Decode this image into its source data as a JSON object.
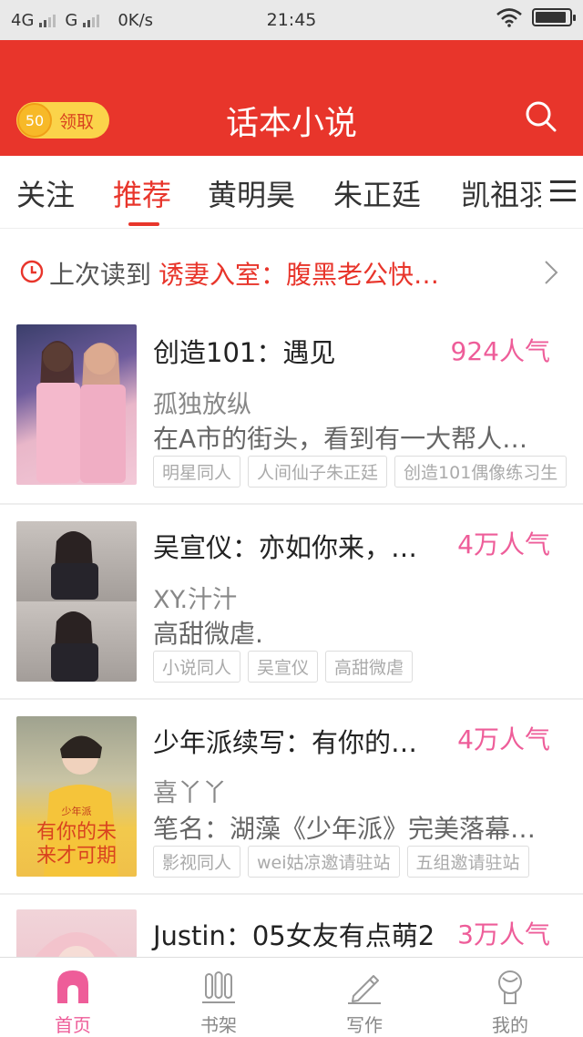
{
  "status_bar": {
    "network1": "4G",
    "network2": "G",
    "speed": "0K/s",
    "time": "21:45"
  },
  "header": {
    "coin_count": "50",
    "claim_label": "领取",
    "title": "话本小说",
    "search_icon": "search-icon"
  },
  "tabs": [
    {
      "label": "关注"
    },
    {
      "label": "推荐"
    },
    {
      "label": "黄明昊"
    },
    {
      "label": "朱正廷"
    },
    {
      "label": "凯祖羽"
    }
  ],
  "last_read": {
    "prefix": "上次读到",
    "title": "诱妻入室：腹黑老公快…"
  },
  "books": [
    {
      "title": "创造101：遇见",
      "popularity": "924人气",
      "author": "孤独放纵",
      "description": "在A市的街头，看到有一大帮人…",
      "tags": [
        "明星同人",
        "人间仙子朱正廷",
        "创造101偶像练习生"
      ]
    },
    {
      "title": "吴宣仪：亦如你来，…",
      "popularity": "4万人气",
      "author": "XY.汁汁",
      "description": "高甜微虐.",
      "tags": [
        "小说同人",
        "吴宣仪",
        "高甜微虐"
      ]
    },
    {
      "title": "少年派续写：有你的…",
      "popularity": "4万人气",
      "author": "喜丫丫",
      "description": "笔名：湖藻《少年派》完美落幕…",
      "cover_text_1": "少年派",
      "cover_text_2": "有你的未",
      "cover_text_3": "来才可期",
      "tags": [
        "影视同人",
        "wei姑凉邀请驻站",
        "五组邀请驻站"
      ]
    },
    {
      "title": "Justin：05女友有点萌2",
      "popularity": "3万人气"
    }
  ],
  "bottom_nav": [
    {
      "label": "首页",
      "icon": "home-icon"
    },
    {
      "label": "书架",
      "icon": "bookshelf-icon"
    },
    {
      "label": "写作",
      "icon": "pencil-icon"
    },
    {
      "label": "我的",
      "icon": "profile-icon"
    }
  ],
  "colors": {
    "brand_red": "#e8352b",
    "popularity_pink": "#ee5d99",
    "coin_yellow": "#fbd34a"
  }
}
